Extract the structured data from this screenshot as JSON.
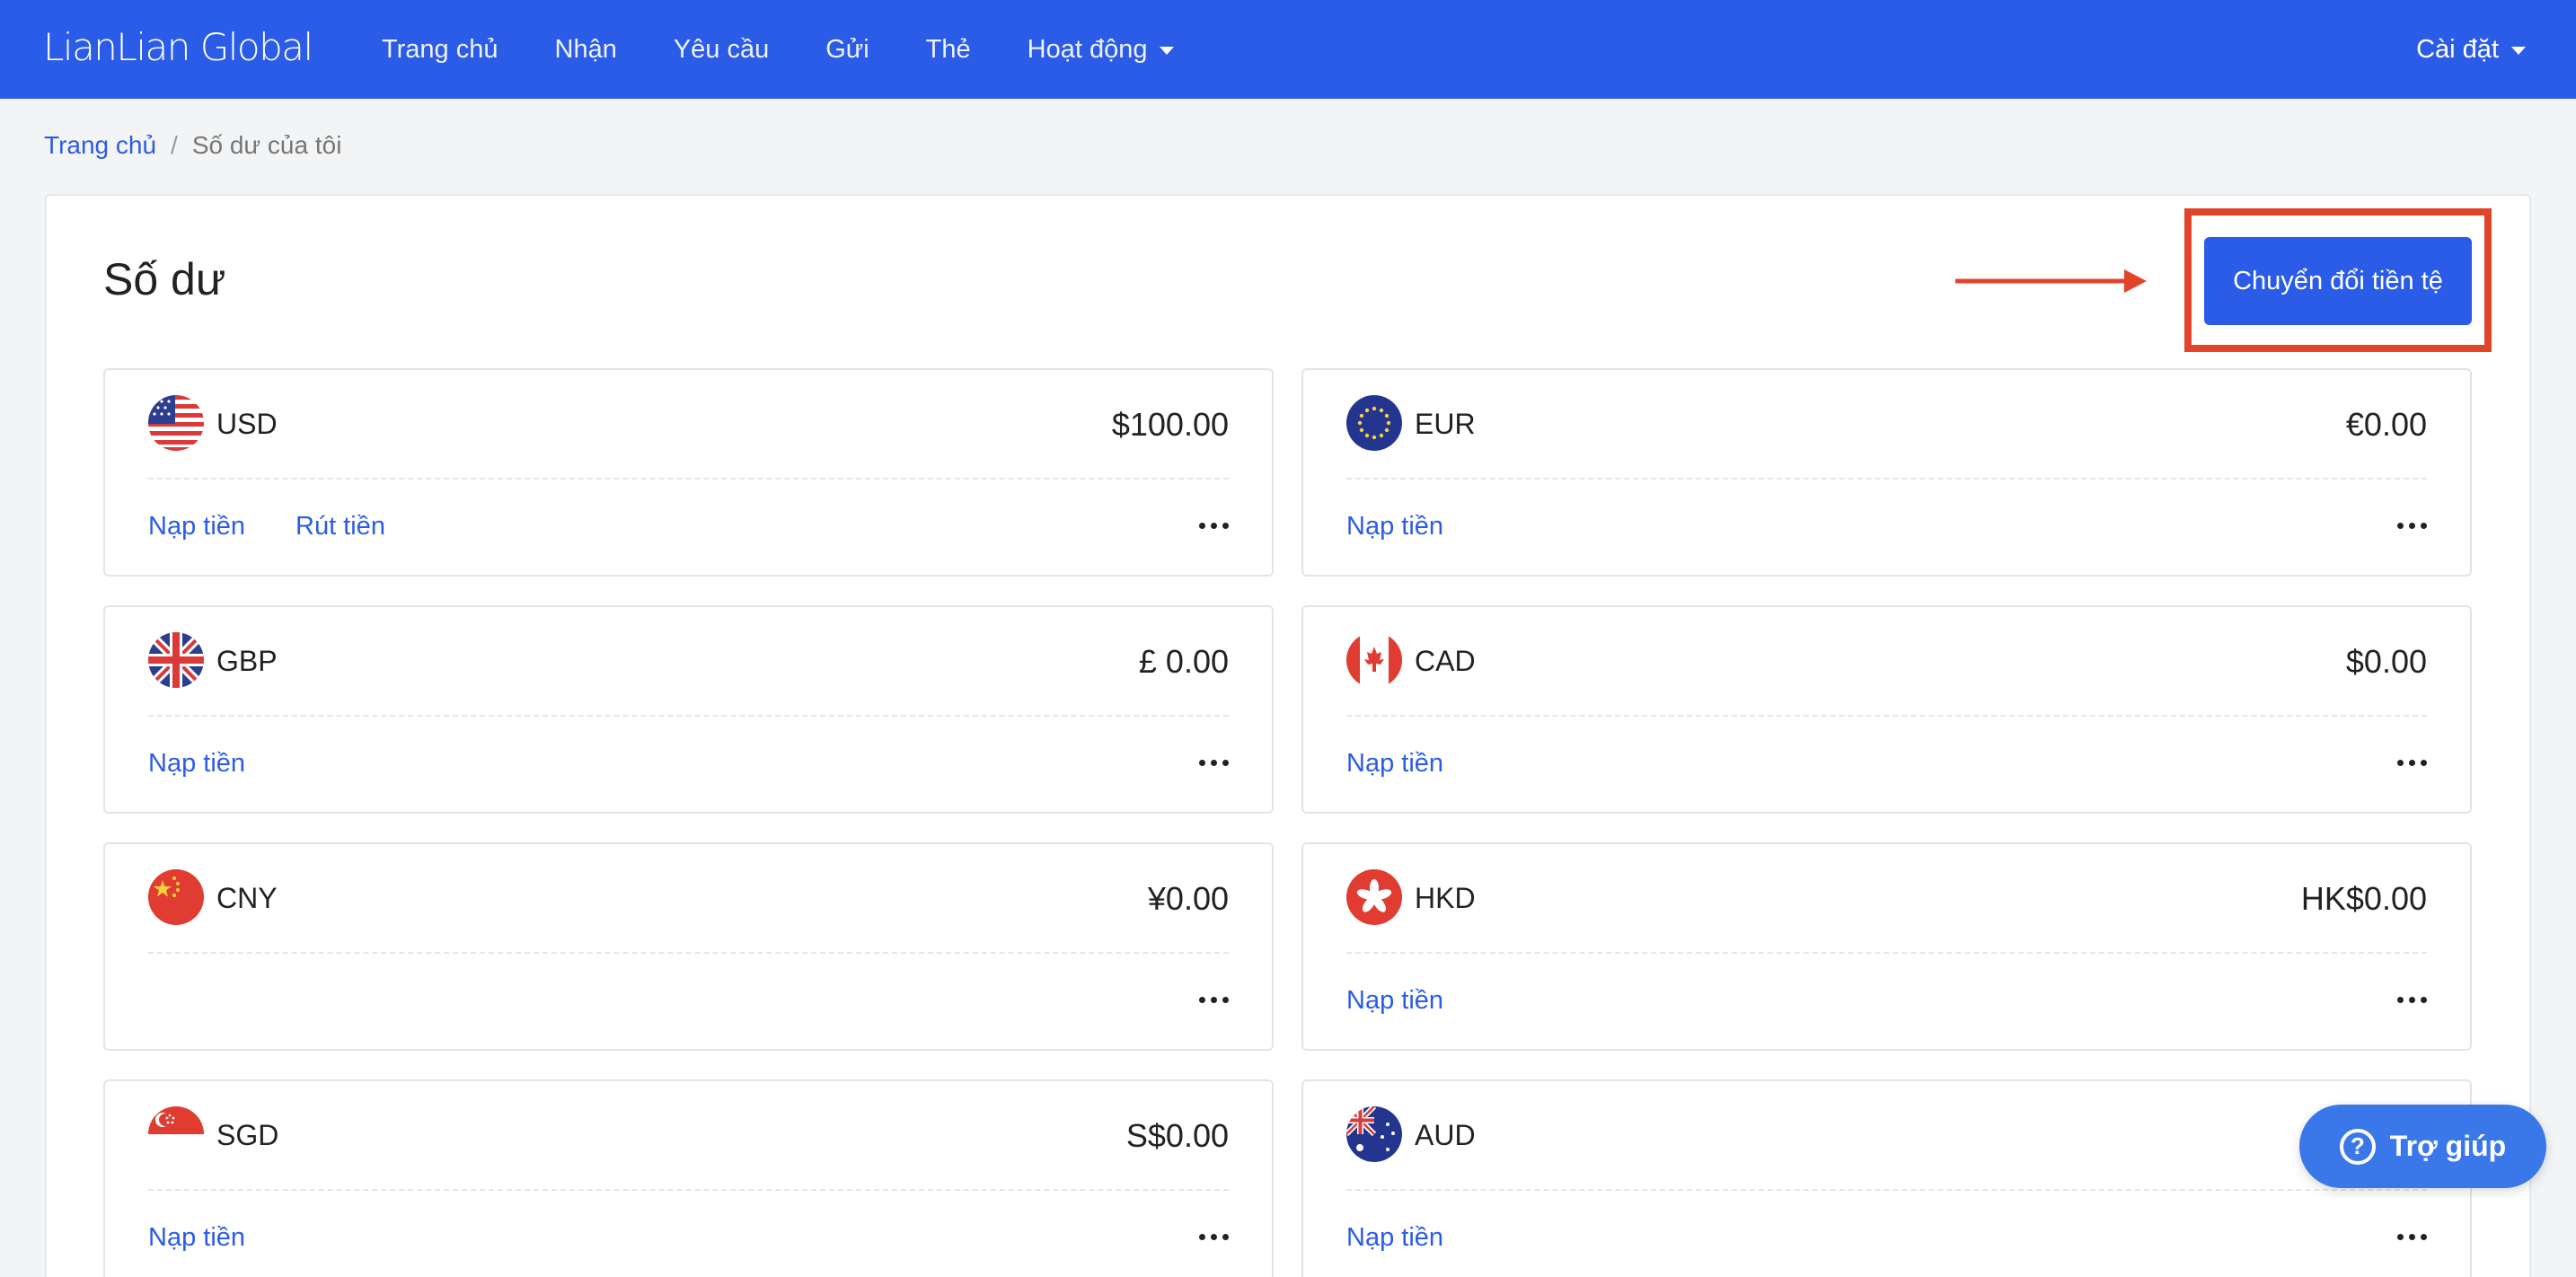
{
  "brand": {
    "logo_text": "LianLian Global",
    "primary_color": "#2b5ce8",
    "highlight_color": "#e2442a"
  },
  "nav": {
    "items": [
      {
        "label": "Trang chủ"
      },
      {
        "label": "Nhận"
      },
      {
        "label": "Yêu cầu"
      },
      {
        "label": "Gửi"
      },
      {
        "label": "Thẻ"
      },
      {
        "label": "Hoạt động",
        "has_dropdown": true
      }
    ],
    "settings_label": "Cài đặt"
  },
  "breadcrumb": {
    "home": "Trang chủ",
    "separator": "/",
    "current": "Số dư của tôi"
  },
  "page": {
    "title": "Số dư",
    "convert_button": "Chuyển đổi tiền tệ"
  },
  "balances": [
    {
      "code": "USD",
      "amount": "$100.00",
      "flag": "us-flag-icon",
      "actions": [
        "Nạp tiền",
        "Rút tiền"
      ]
    },
    {
      "code": "EUR",
      "amount": "€0.00",
      "flag": "eu-flag-icon",
      "actions": [
        "Nạp tiền"
      ]
    },
    {
      "code": "GBP",
      "amount": "£ 0.00",
      "flag": "uk-flag-icon",
      "actions": [
        "Nạp tiền"
      ]
    },
    {
      "code": "CAD",
      "amount": "$0.00",
      "flag": "canada-flag-icon",
      "actions": [
        "Nạp tiền"
      ]
    },
    {
      "code": "CNY",
      "amount": "¥0.00",
      "flag": "china-flag-icon",
      "actions": []
    },
    {
      "code": "HKD",
      "amount": "HK$0.00",
      "flag": "hong-kong-flag-icon",
      "actions": [
        "Nạp tiền"
      ]
    },
    {
      "code": "SGD",
      "amount": "S$0.00",
      "flag": "singapore-flag-icon",
      "actions": [
        "Nạp tiền"
      ]
    },
    {
      "code": "AUD",
      "amount": "",
      "flag": "australia-flag-icon",
      "actions": [
        "Nạp tiền"
      ]
    }
  ],
  "help": {
    "label": "Trợ giúp",
    "icon": "question-icon"
  }
}
